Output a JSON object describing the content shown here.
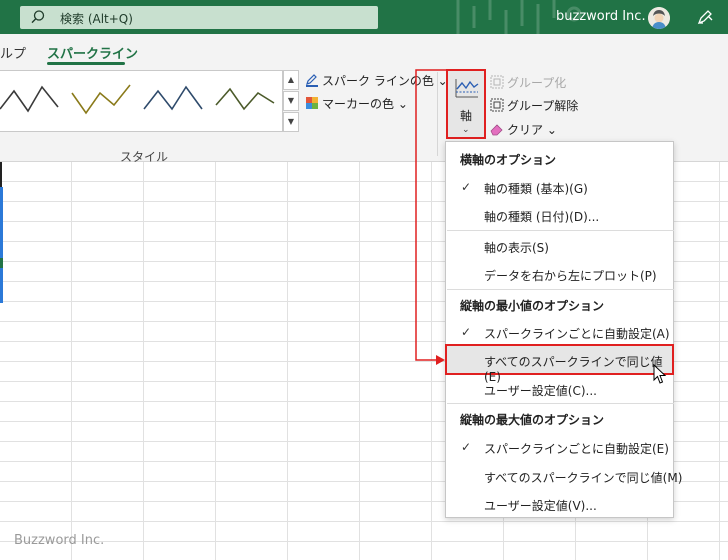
{
  "titlebar": {
    "search_placeholder": "検索 (Alt+Q)",
    "company": "buzzword Inc."
  },
  "tabs": {
    "help_partial": "ルプ",
    "sparkline": "スパークライン"
  },
  "ribbon": {
    "style_group_label": "スタイル",
    "sparkline_color": "スパーク ラインの色",
    "marker_color": "マーカーの色",
    "axis_label": "軸",
    "group": "グループ化",
    "ungroup": "グループ解除",
    "clear": "クリア",
    "colors": {
      "accent": "#217346",
      "highlight": "#e02020"
    }
  },
  "menu": {
    "section_horizontal": "横軸のオプション",
    "axis_type_general": "軸の種類 (基本)(G)",
    "axis_type_date": "軸の種類 (日付)(D)...",
    "show_axis": "軸の表示(S)",
    "plot_right_to_left": "データを右から左にプロット(P)",
    "section_min": "縦軸の最小値のオプション",
    "min_auto": "スパークラインごとに自動設定(A)",
    "min_same": "すべてのスパークラインで同じ値(E)",
    "min_custom": "ユーザー設定値(C)...",
    "section_max": "縦軸の最大値のオプション",
    "max_auto": "スパークラインごとに自動設定(E)",
    "max_same": "すべてのスパークラインで同じ値(M)",
    "max_custom": "ユーザー設定値(V)...",
    "checkmark": "✓"
  },
  "watermark": "Buzzword Inc."
}
